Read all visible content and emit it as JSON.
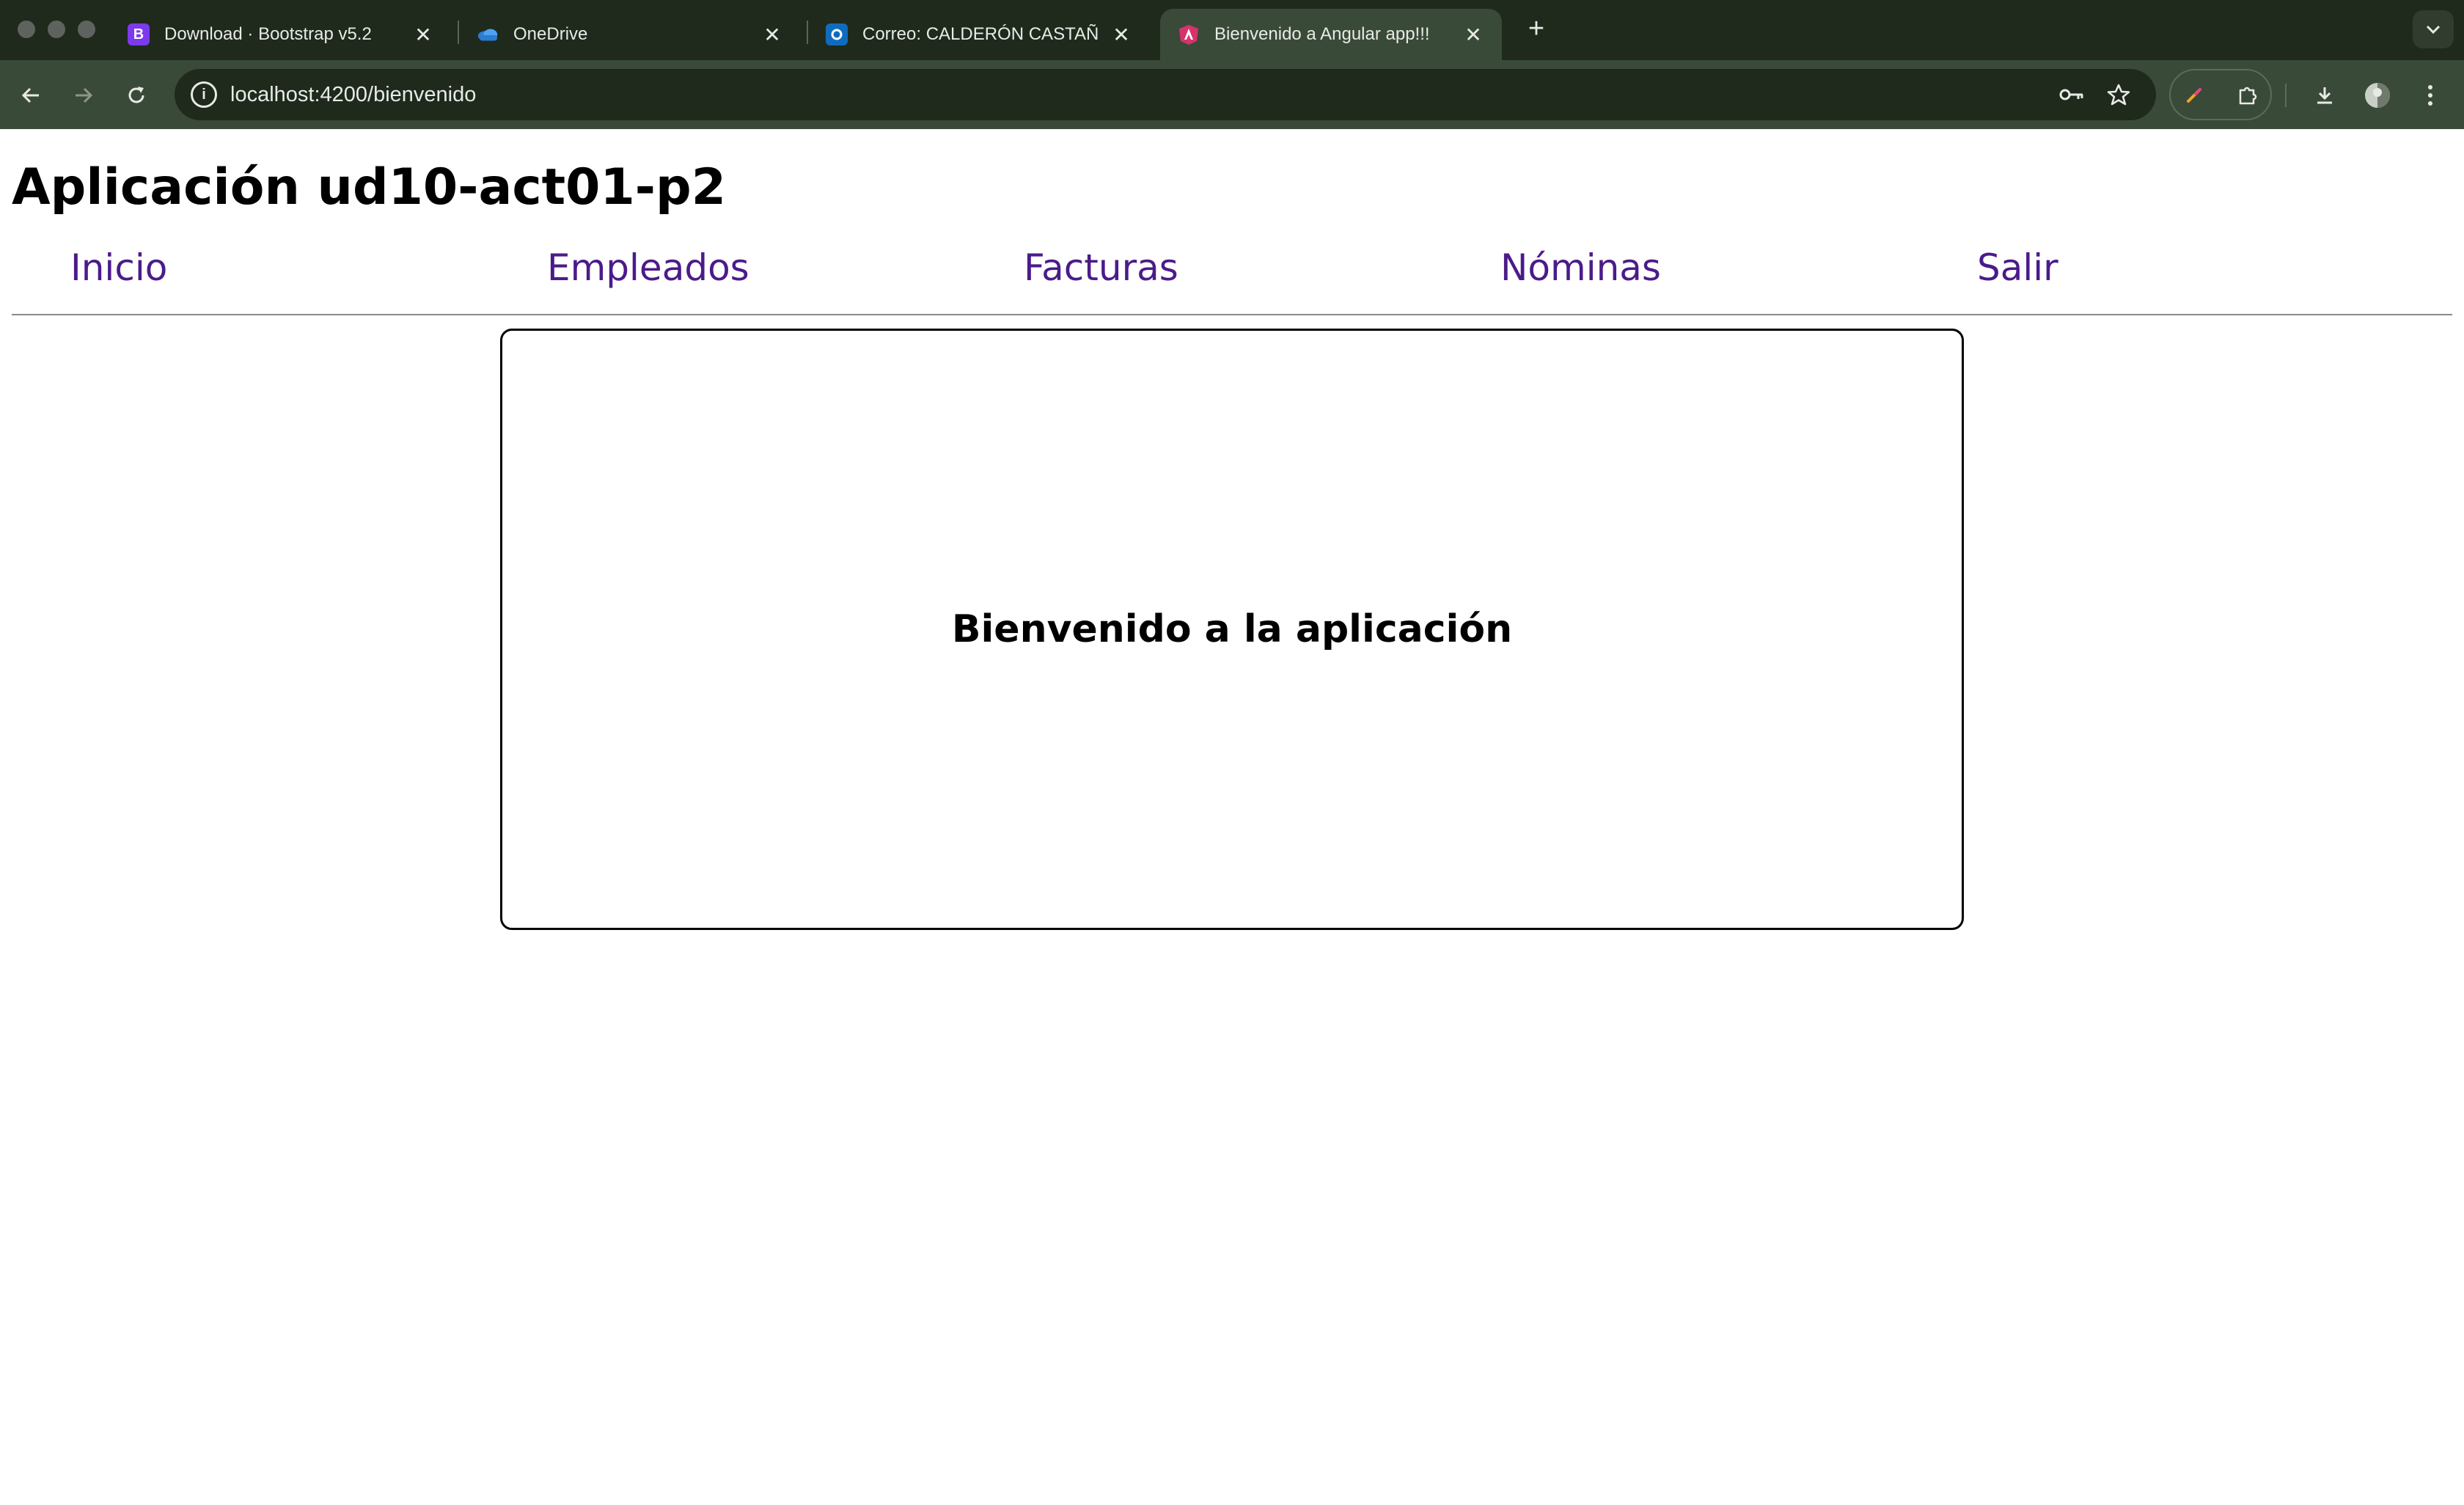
{
  "browser": {
    "tabs": [
      {
        "title": "Download · Bootstrap v5.2",
        "favicon": "bootstrap-icon",
        "favicon_color": "#7c3aed",
        "active": false
      },
      {
        "title": "OneDrive",
        "favicon": "onedrive-cloud-icon",
        "favicon_color": "#2b7cd3",
        "active": false
      },
      {
        "title": "Correo: CALDERÓN CASTAÑO",
        "favicon": "outlook-icon",
        "favicon_color": "#0f6cbd",
        "active": false
      },
      {
        "title": "Bienvenido a Angular app!!!",
        "favicon": "angular-icon",
        "favicon_color": "#d6336c",
        "active": true
      }
    ],
    "bootstrap_glyph": "B",
    "new_tab_glyph": "+",
    "close_glyph": "✕",
    "address": "localhost:4200/bienvenido"
  },
  "app": {
    "title": "Aplicación ud10-act01-p2",
    "nav": [
      "Inicio",
      "Empleados",
      "Facturas",
      "Nóminas",
      "Salir"
    ],
    "welcome": "Bienvenido a la aplicación"
  },
  "colors": {
    "nav_link": "#4b1b8a",
    "chrome_dark": "#1f2a1d",
    "chrome_toolbar": "#3a4a38"
  }
}
